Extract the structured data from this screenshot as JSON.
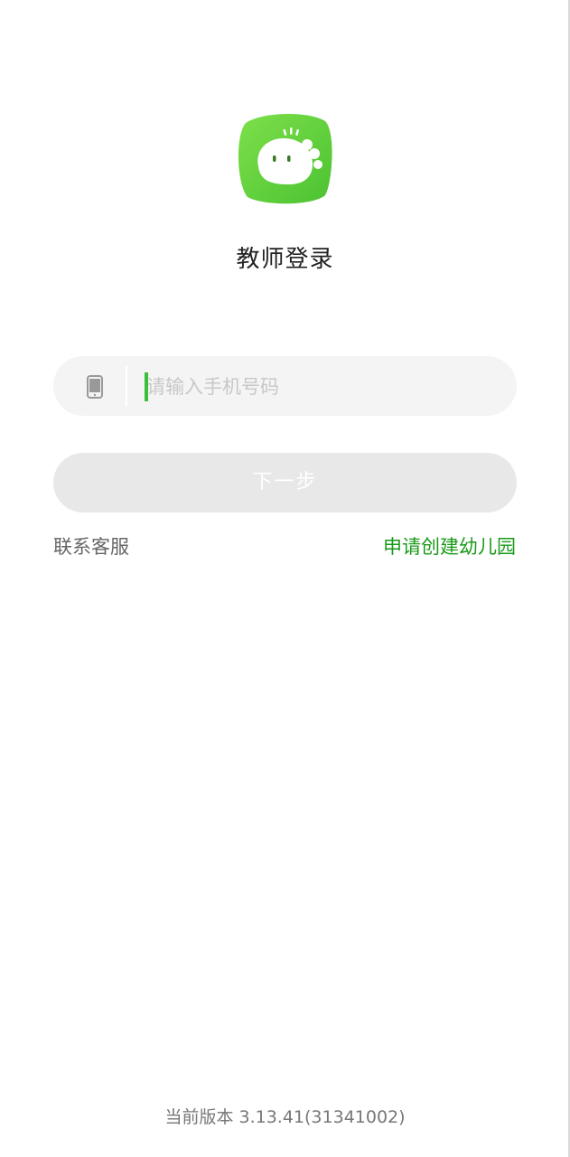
{
  "login": {
    "title": "教师登录",
    "phone_placeholder": "请输入手机号码",
    "phone_value": "",
    "next_label": "下一步",
    "contact_label": "联系客服",
    "apply_label": "申请创建幼儿园"
  },
  "footer": {
    "version_text": "当前版本 3.13.41(31341002)"
  },
  "icons": {
    "logo": "dinosaur-app-logo",
    "phone": "phone-icon"
  },
  "colors": {
    "accent_green": "#5cd13a",
    "link_green": "#1a9a1a",
    "button_disabled": "#e8e8e8",
    "field_bg": "#f4f4f4"
  }
}
